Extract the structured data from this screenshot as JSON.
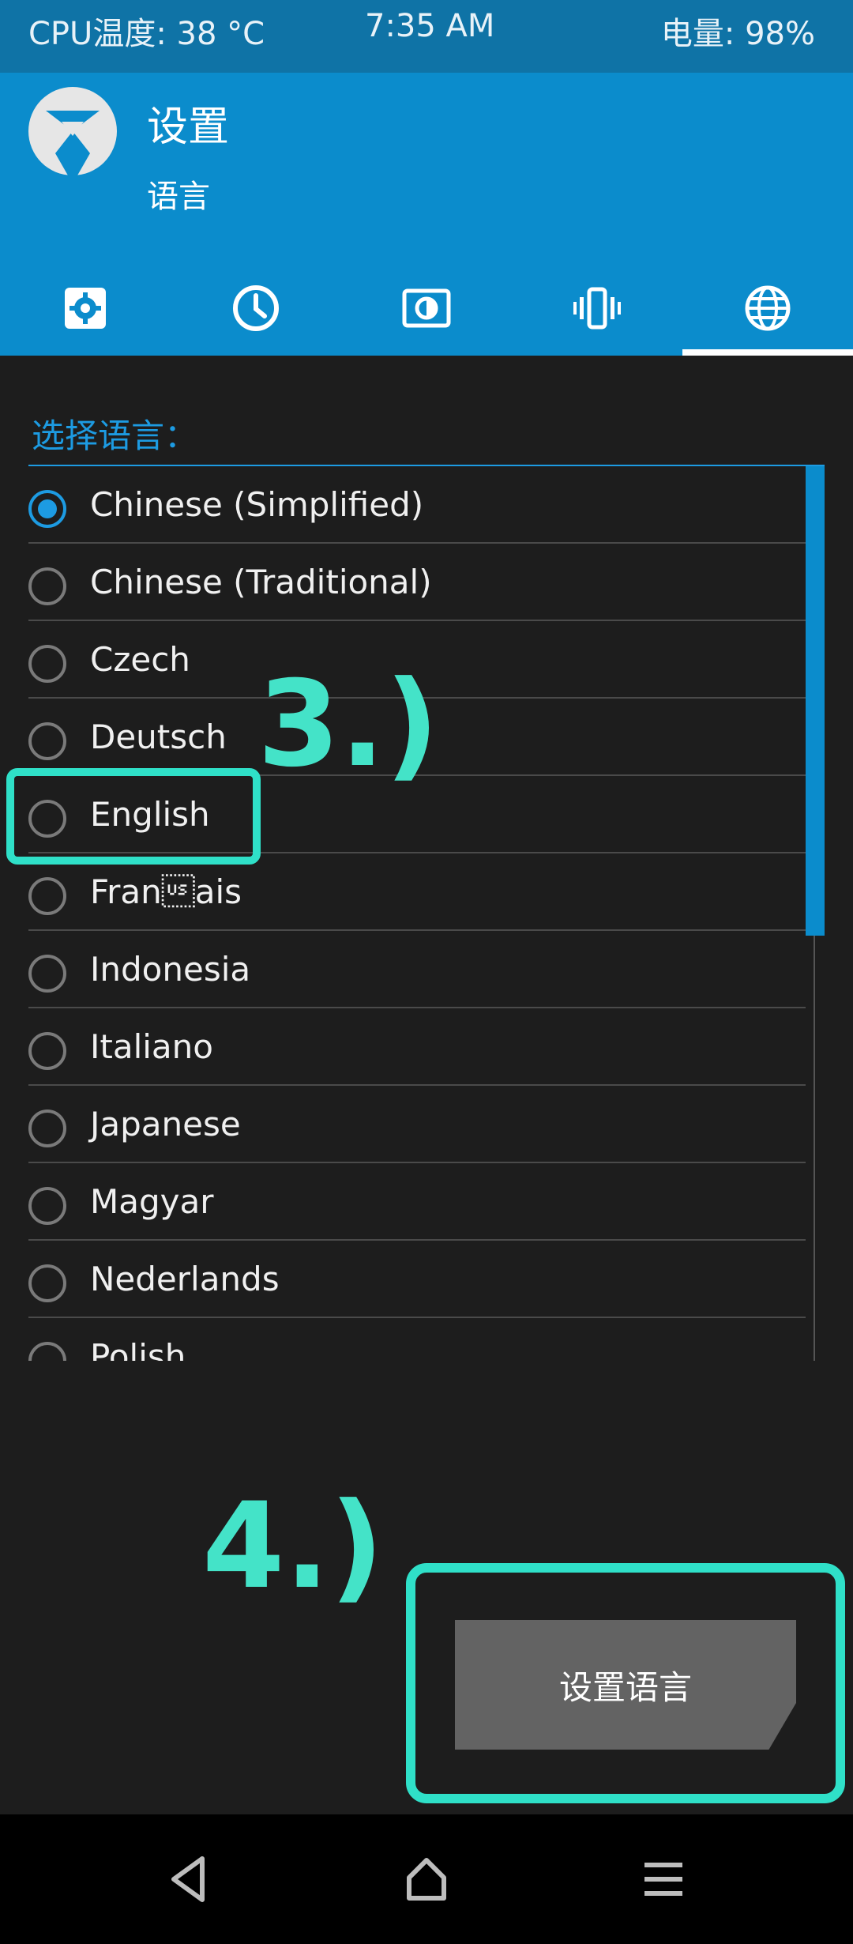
{
  "status_bar": {
    "cpu_temp": "CPU温度: 38 °C",
    "time": "7:35 AM",
    "battery": "电量: 98%"
  },
  "header": {
    "title": "设置",
    "subtitle": "语言",
    "logo_icon": "twrp-logo-icon"
  },
  "tabs": [
    {
      "icon": "gear-icon",
      "selected": false
    },
    {
      "icon": "clock-icon",
      "selected": false
    },
    {
      "icon": "brightness-icon",
      "selected": false
    },
    {
      "icon": "vibration-icon",
      "selected": false
    },
    {
      "icon": "globe-icon",
      "selected": true
    }
  ],
  "language_select": {
    "prompt": "选择语言：",
    "items": [
      {
        "label": "Chinese (Simplified)",
        "checked": true
      },
      {
        "label": "Chinese (Traditional)",
        "checked": false
      },
      {
        "label": "Czech",
        "checked": false
      },
      {
        "label": "Deutsch",
        "checked": false
      },
      {
        "label": "English",
        "checked": false
      },
      {
        "label": "Fran\u001fais",
        "checked": false
      },
      {
        "label": "Indonesia",
        "checked": false
      },
      {
        "label": "Italiano",
        "checked": false
      },
      {
        "label": "Japanese",
        "checked": false
      },
      {
        "label": "Magyar",
        "checked": false
      },
      {
        "label": "Nederlands",
        "checked": false
      },
      {
        "label": "Polish",
        "checked": false
      }
    ]
  },
  "action_button": {
    "label": "设置语言"
  },
  "annotations": {
    "step3": "3.)",
    "step4": "4.)"
  },
  "colors": {
    "header_bg": "#0b8ccc",
    "status_bg": "#0f73a6",
    "accent": "#1d9be2",
    "annotation": "#2fe0c8",
    "background": "#1d1d1d"
  }
}
